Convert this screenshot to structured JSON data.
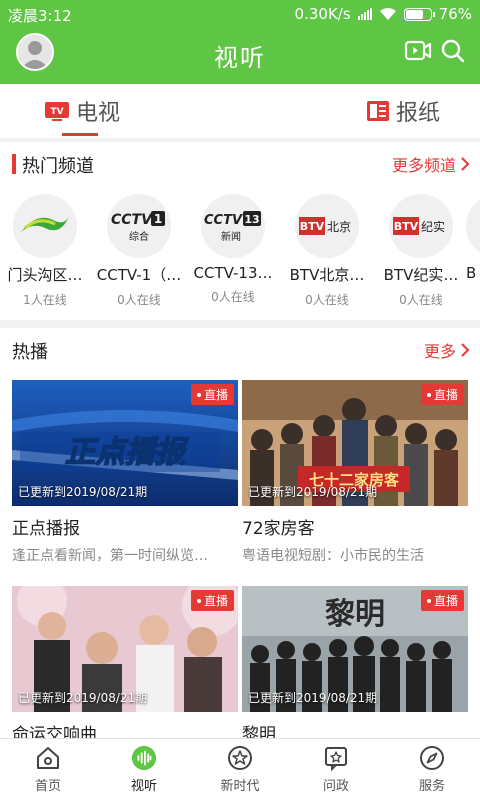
{
  "status_bar": {
    "time": "凌晨3:12",
    "net_speed": "0.30K/s",
    "battery": "76%",
    "battery_level": 0.76
  },
  "header": {
    "title": "视听",
    "icons": [
      "avatar",
      "video-icon",
      "search-icon"
    ]
  },
  "tabs": [
    {
      "label": "电视",
      "icon_text": "TV",
      "active": true
    },
    {
      "label": "报纸",
      "active": false
    }
  ],
  "hot_channels": {
    "title": "热门频道",
    "more": "更多频道",
    "items": [
      {
        "name": "门头沟区…",
        "online": "1人在线"
      },
      {
        "name": "CCTV-1（…",
        "online": "0人在线",
        "logo_text": "CCTV",
        "logo_num": "1",
        "logo_sub": "综合"
      },
      {
        "name": "CCTV-13…",
        "online": "0人在线",
        "logo_text": "CCTV",
        "logo_num": "13",
        "logo_sub": "新闻"
      },
      {
        "name": "BTV北京…",
        "online": "0人在线",
        "logo_badge": "BTV",
        "logo_label": "北京"
      },
      {
        "name": "BTV纪实…",
        "online": "0人在线",
        "logo_badge": "BTV",
        "logo_label": "纪实"
      },
      {
        "name": "B"
      }
    ]
  },
  "hot_shows": {
    "title": "热播",
    "more": "更多",
    "live_label": "直播",
    "items": [
      {
        "title": "正点播报",
        "desc": "逢正点看新闻，第一时间纵览…",
        "updated": "已更新到2019/08/21期",
        "thumb_text": "正点播报"
      },
      {
        "title": "72家房客",
        "desc": "粤语电视短剧：小市民的生活",
        "updated": "已更新到2019/08/21期",
        "thumb_text": "七十二家房客"
      },
      {
        "title": "命运交响曲",
        "desc": "",
        "updated": "已更新到2019/08/21期"
      },
      {
        "title": "黎明",
        "desc": "",
        "updated": "已更新到2019/08/21期",
        "thumb_text": "黎明"
      }
    ]
  },
  "bottom_nav": [
    {
      "label": "首页",
      "icon": "home-icon"
    },
    {
      "label": "视听",
      "icon": "audio-icon",
      "active": true
    },
    {
      "label": "新时代",
      "icon": "star-icon"
    },
    {
      "label": "问政",
      "icon": "inquiry-icon"
    },
    {
      "label": "服务",
      "icon": "compass-icon"
    }
  ],
  "colors": {
    "brand_green": "#5fc544",
    "accent_red": "#e53935"
  }
}
